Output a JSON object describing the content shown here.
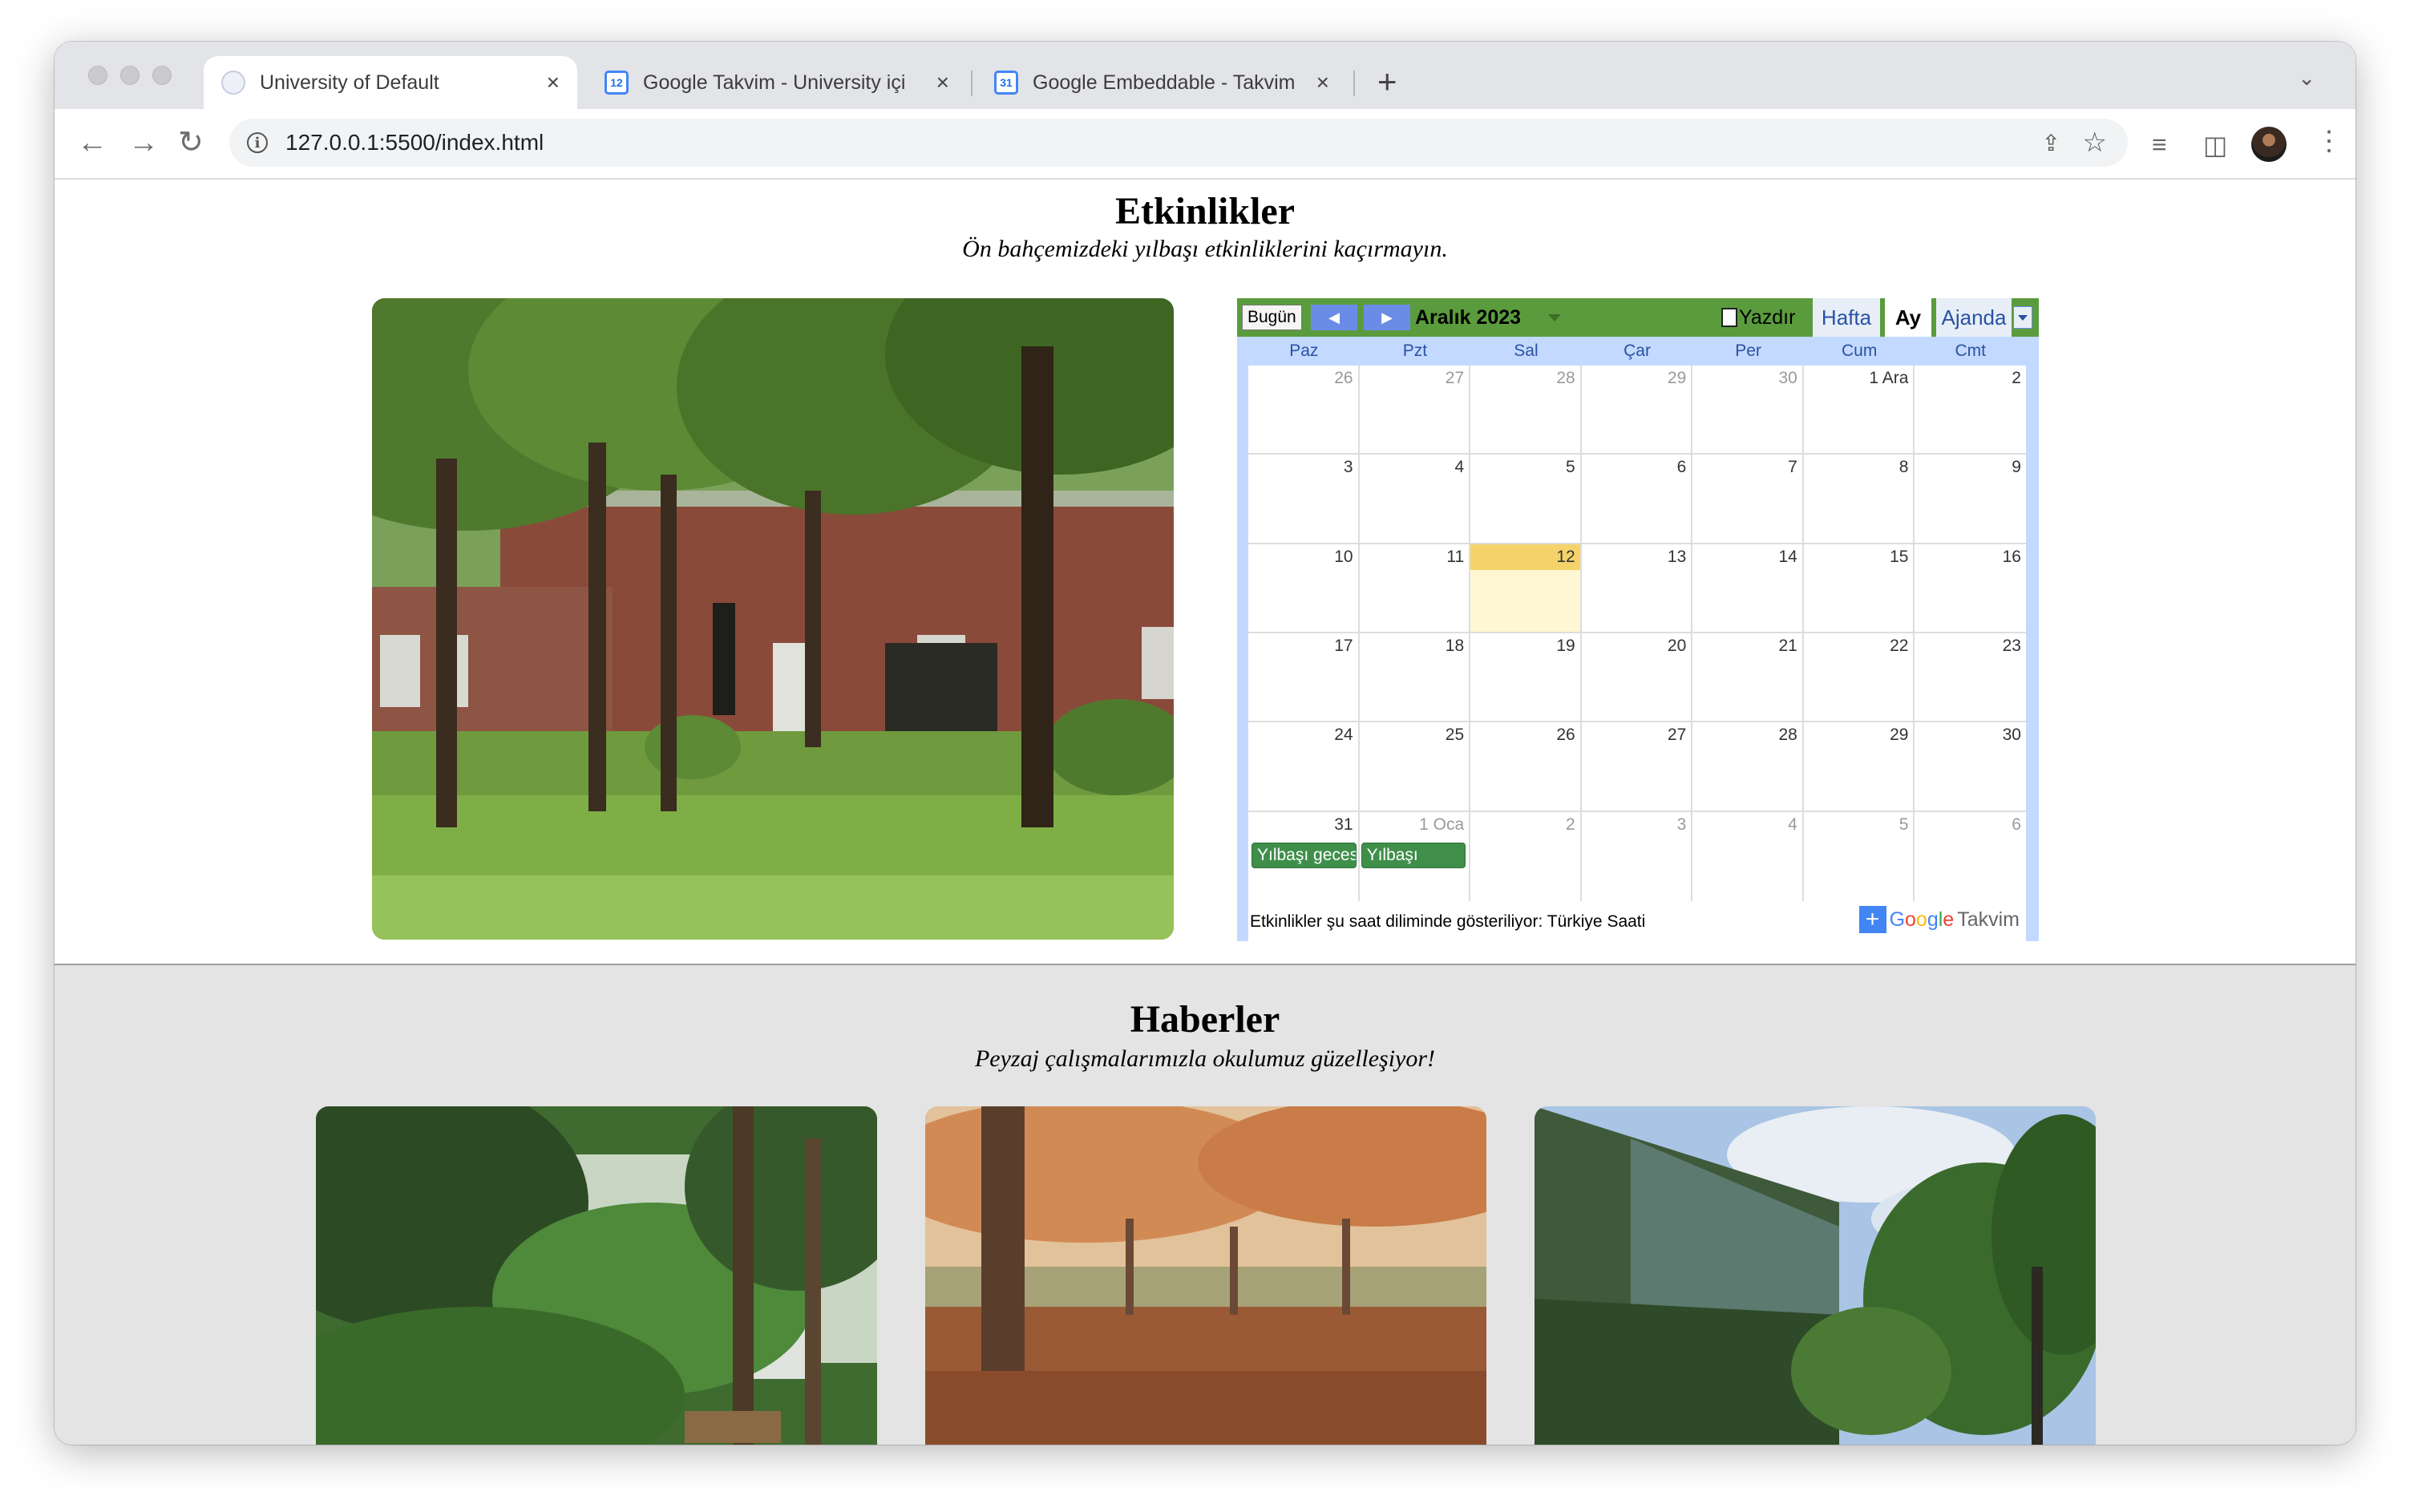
{
  "browser": {
    "tabs": [
      {
        "title": "University of Default",
        "icon": "globe-icon",
        "active": true
      },
      {
        "title": "Google Takvim - University içi",
        "icon": "google-calendar-icon",
        "badge": "12"
      },
      {
        "title": "Google Embeddable - Takvim",
        "icon": "google-calendar-icon",
        "badge": "31"
      }
    ],
    "new_tab": "+",
    "url": "127.0.0.1:5500/index.html"
  },
  "events": {
    "title": "Etkinlikler",
    "subtitle": "Ön bahçemizdeki yılbaşı etkinliklerini kaçırmayın."
  },
  "calendar": {
    "today_label": "Bugün",
    "month_label": "Aralık 2023",
    "print_label": "Yazdır",
    "views": [
      "Hafta",
      "Ay",
      "Ajanda"
    ],
    "selected_view": "Ay",
    "weekdays": [
      "Paz",
      "Pzt",
      "Sal",
      "Çar",
      "Per",
      "Cum",
      "Cmt"
    ],
    "weeks": [
      [
        "26",
        "27",
        "28",
        "29",
        "30",
        "1 Ara",
        "2"
      ],
      [
        "3",
        "4",
        "5",
        "6",
        "7",
        "8",
        "9"
      ],
      [
        "10",
        "11",
        "12",
        "13",
        "14",
        "15",
        "16"
      ],
      [
        "17",
        "18",
        "19",
        "20",
        "21",
        "22",
        "23"
      ],
      [
        "24",
        "25",
        "26",
        "27",
        "28",
        "29",
        "30"
      ],
      [
        "31",
        "1 Oca",
        "2",
        "3",
        "4",
        "5",
        "6"
      ]
    ],
    "today": "12",
    "events": [
      {
        "title": "Yılbaşı gecesi",
        "day": "31"
      },
      {
        "title": "Yılbaşı",
        "day": "1 Oca"
      }
    ],
    "timezone_note": "Etkinlikler şu saat diliminde gösteriliyor: Türkiye Saati",
    "logo": {
      "plus": "+",
      "brand": "Google",
      "product": "Takvim"
    },
    "colors": {
      "header": "#5a9c3d",
      "today": "#f5d36a",
      "event": "#3f8f4a"
    }
  },
  "news": {
    "title": "Haberler",
    "subtitle": "Peyzaj çalışmalarımızla okulumuz güzelleşiyor!"
  }
}
